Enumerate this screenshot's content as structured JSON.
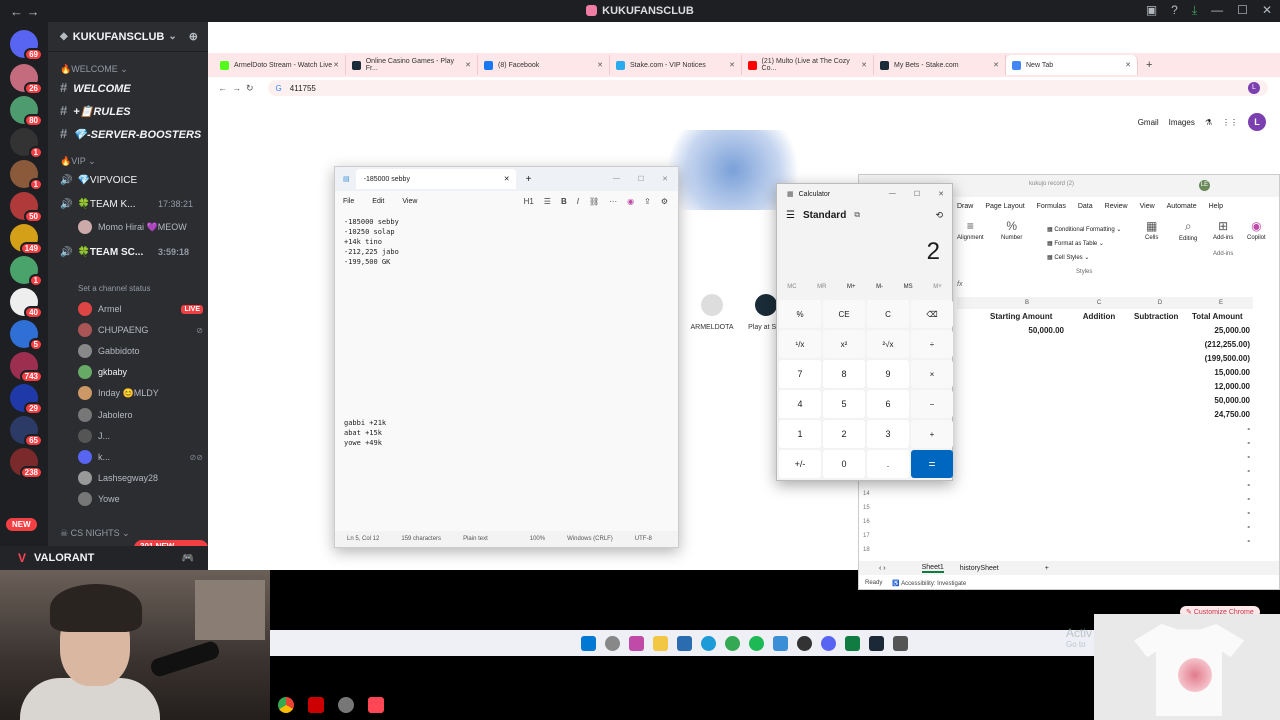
{
  "discord": {
    "window_title": "KUKUFANSCLUB",
    "server_name": "KUKUFANSCLUB",
    "categories": {
      "welcome": "WELCOME",
      "vip": "VIP",
      "cs": "CS NIGHTS"
    },
    "channels": {
      "welcome": "WELCOME",
      "rules": "RULES",
      "boosters": "-SERVER-BOOSTERS"
    },
    "voice": {
      "vip_voice": "VIPVOICE",
      "team_k": "TEAM K...",
      "team_k_time": "17:38:21",
      "team_sc": "TEAM SC...",
      "team_sc_time": "3:59:18",
      "set_status": "Set a channel status"
    },
    "team_k_users": [
      {
        "name": "Momo Hirai",
        "tag": "MEOW"
      }
    ],
    "team_sc_users": [
      {
        "name": "Armel",
        "badge": "LIVE"
      },
      {
        "name": "CHUPAENG"
      },
      {
        "name": "Gabbidoto"
      },
      {
        "name": "gkbaby"
      },
      {
        "name": "Inday",
        "tag": "MLDY"
      },
      {
        "name": "Jabolero"
      },
      {
        "name": "J..."
      },
      {
        "name": "k..."
      },
      {
        "name": "Lashsegway28"
      },
      {
        "name": "Yowe"
      }
    ],
    "mentions_pill": "301 NEW MENTIONS",
    "new_pill": "NEW",
    "voice_connected_game": "VALORANT",
    "server_badges": [
      "69",
      "26",
      "80",
      "1",
      "1",
      "50",
      "149",
      "1",
      "40",
      "5",
      "743",
      "29",
      "65",
      "238"
    ]
  },
  "chrome": {
    "tabs": [
      {
        "title": "ArmelDoto Stream - Watch Live",
        "color": "#53fc18"
      },
      {
        "title": "Online Casino Games - Play Fr...",
        "color": "#1a2c38"
      },
      {
        "title": "(8) Facebook",
        "color": "#1877f2"
      },
      {
        "title": "Stake.com - VIP Notices",
        "color": "#2aabee"
      },
      {
        "title": "(21) Multo (Live at The Cozy Co...",
        "color": "#ff0000"
      },
      {
        "title": "My Bets - Stake.com",
        "color": "#1a2c38"
      },
      {
        "title": "New Tab",
        "color": "#4285f4",
        "active": true
      }
    ],
    "omnibox": "411755",
    "profile_initial": "L",
    "google_links": {
      "gmail": "Gmail",
      "images": "Images"
    },
    "shortcuts": [
      {
        "label": "ARMELDOTA"
      },
      {
        "label": "Play at St..."
      }
    ],
    "customize": "Customize Chrome"
  },
  "notepad": {
    "tab_title": "-185000 sebby",
    "menu": [
      "File",
      "Edit",
      "View"
    ],
    "heading_btn": "H1",
    "lines": [
      "-185000 sebby",
      "-10250 solap",
      "+14k tino",
      "-212,225 jabo",
      "-199,500 GK"
    ],
    "lines2": [
      "gabbi +21k",
      "abat +15k",
      "yowe +49k"
    ],
    "status": {
      "pos": "Ln 5, Col 12",
      "chars": "159 characters",
      "format": "Plain text",
      "zoom": "100%",
      "eol": "Windows (CRLF)",
      "enc": "UTF-8"
    }
  },
  "calculator": {
    "title": "Calculator",
    "mode": "Standard",
    "display": "2",
    "memory": [
      "MC",
      "MR",
      "M+",
      "M-",
      "MS",
      "M˅"
    ],
    "keys": [
      "%",
      "CE",
      "C",
      "⌫",
      "¹/x",
      "x²",
      "²√x",
      "÷",
      "7",
      "8",
      "9",
      "×",
      "4",
      "5",
      "6",
      "−",
      "1",
      "2",
      "3",
      "+",
      "+/-",
      "0",
      ".",
      "="
    ]
  },
  "excel": {
    "file_name": "kukujo record (2)",
    "profile": "LE",
    "tabs": [
      "Draw",
      "Page Layout",
      "Formulas",
      "Data",
      "Review",
      "View",
      "Automate",
      "Help"
    ],
    "ribbon": {
      "alignment": "Alignment",
      "number": "Number",
      "cells": "Cells",
      "editing": "Editing",
      "addins": "Add-ins",
      "copilot": "Copilot",
      "cond": "Conditional Formatting",
      "table": "Format as Table",
      "cellstyles": "Cell Styles",
      "styles_group": "Styles",
      "addins_group": "Add-ins"
    },
    "fx": "fx",
    "columns": [
      "B",
      "C",
      "D",
      "E",
      "F"
    ],
    "headers": [
      "Starting Amount",
      "Addition",
      "Subtraction",
      "Total Amount"
    ],
    "starting_amount": "50,000.00",
    "totals": [
      "25,000.00",
      "(212,255.00)",
      "(199,500.00)",
      "15,000.00",
      "12,000.00",
      "50,000.00",
      "24,750.00",
      "-",
      "-",
      "-",
      "-",
      "-",
      "-",
      "-",
      "-",
      "-"
    ],
    "row_numbers": [
      "13",
      "14",
      "15",
      "16",
      "17",
      "18"
    ],
    "sheets": [
      "Sheet1",
      "historySheet"
    ],
    "status_ready": "Ready",
    "status_access": "Accessibility: Investigate"
  },
  "windows": {
    "activate": "Activ",
    "activate2": "Go to"
  }
}
